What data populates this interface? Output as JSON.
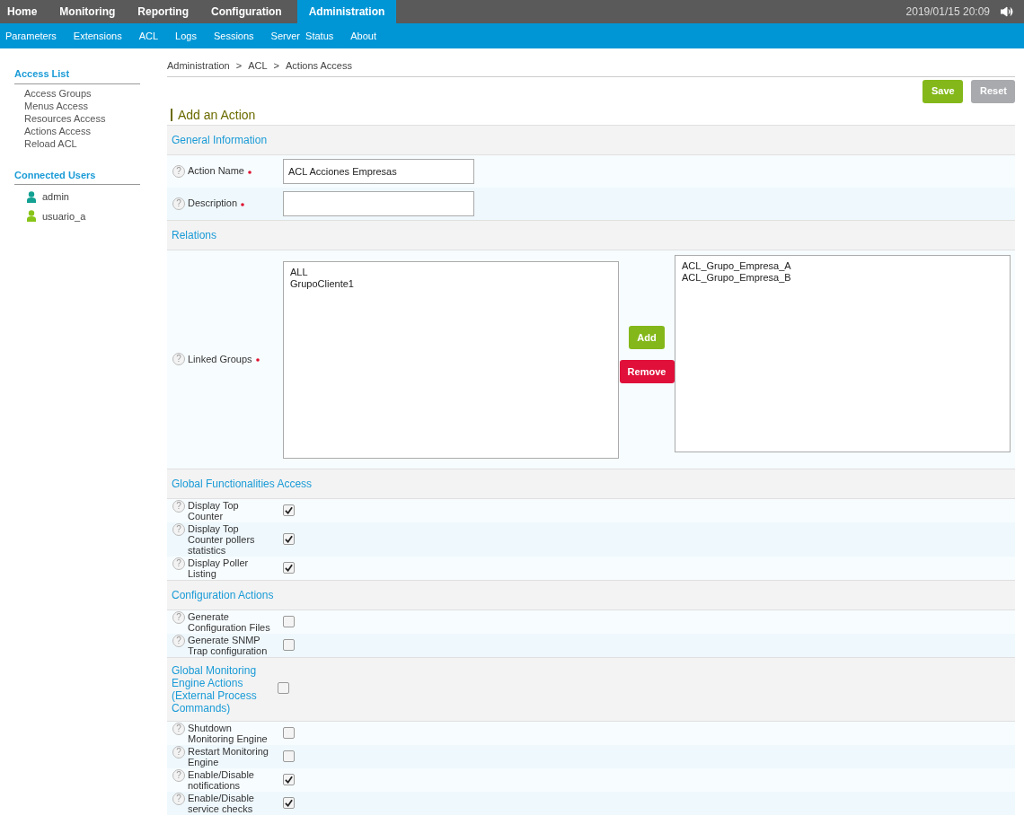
{
  "nav": {
    "tabs": [
      {
        "label": "Home",
        "selected": false
      },
      {
        "label": "Monitoring",
        "selected": false
      },
      {
        "label": "Reporting",
        "selected": false
      },
      {
        "label": "Configuration",
        "selected": false
      },
      {
        "label": "Administration",
        "selected": true
      }
    ],
    "datetime": "2019/01/15 20:09"
  },
  "subnav": [
    "Parameters",
    "Extensions",
    "ACL",
    "Logs",
    "Sessions",
    "Server  Status",
    "About"
  ],
  "sidebar": {
    "access_list": {
      "title": "Access List",
      "items": [
        "Access Groups",
        "Menus Access",
        "Resources Access",
        "Actions Access",
        "Reload ACL"
      ]
    },
    "connected_users": {
      "title": "Connected Users",
      "users": [
        {
          "name": "admin",
          "color": "#12a192"
        },
        {
          "name": "usuario_a",
          "color": "#88c418"
        }
      ]
    }
  },
  "breadcrumb": {
    "items": [
      "Administration",
      "ACL",
      "Actions Access"
    ],
    "separator": ">"
  },
  "buttons": [
    {
      "label": "Save",
      "kind": "save"
    },
    {
      "label": "Reset",
      "kind": "reset"
    }
  ],
  "form_title": "Add an Action",
  "help_glyph": "?",
  "sections": [
    {
      "title": "General Information",
      "kind": "fields",
      "rows": [
        {
          "label": "Action Name",
          "required": true,
          "value": "ACL Acciones Empresas"
        },
        {
          "label": "Description",
          "required": true
        }
      ]
    },
    {
      "title": "Relations",
      "kind": "relation",
      "label": "Linked Groups",
      "required": true,
      "available": [
        "ALL",
        "GrupoCliente1"
      ],
      "chosen": [
        "ACL_Grupo_Empresa_A",
        "ACL_Grupo_Empresa_B"
      ],
      "add": "Add",
      "remove": "Remove"
    },
    {
      "title": "Global Functionalities Access",
      "kind": "checks",
      "rows": [
        {
          "label": "Display Top Counter",
          "checked": true
        },
        {
          "label": "Display Top Counter pollers statistics",
          "checked": true
        },
        {
          "label": "Display Poller Listing",
          "checked": true
        }
      ]
    },
    {
      "title": "Configuration Actions",
      "kind": "checks",
      "rows": [
        {
          "label": "Generate Configuration Files",
          "checked": false
        },
        {
          "label": "Generate SNMP Trap configuration",
          "checked": false
        }
      ]
    },
    {
      "title": "Global Monitoring Engine Actions (External Process Commands)",
      "kind": "checks",
      "checked": false,
      "rows": [
        {
          "label": "Shutdown Monitoring Engine",
          "checked": false
        },
        {
          "label": "Restart Monitoring Engine",
          "checked": false
        },
        {
          "label": "Enable/Disable notifications",
          "checked": true
        },
        {
          "label": "Enable/Disable service checks",
          "checked": true
        }
      ]
    }
  ]
}
